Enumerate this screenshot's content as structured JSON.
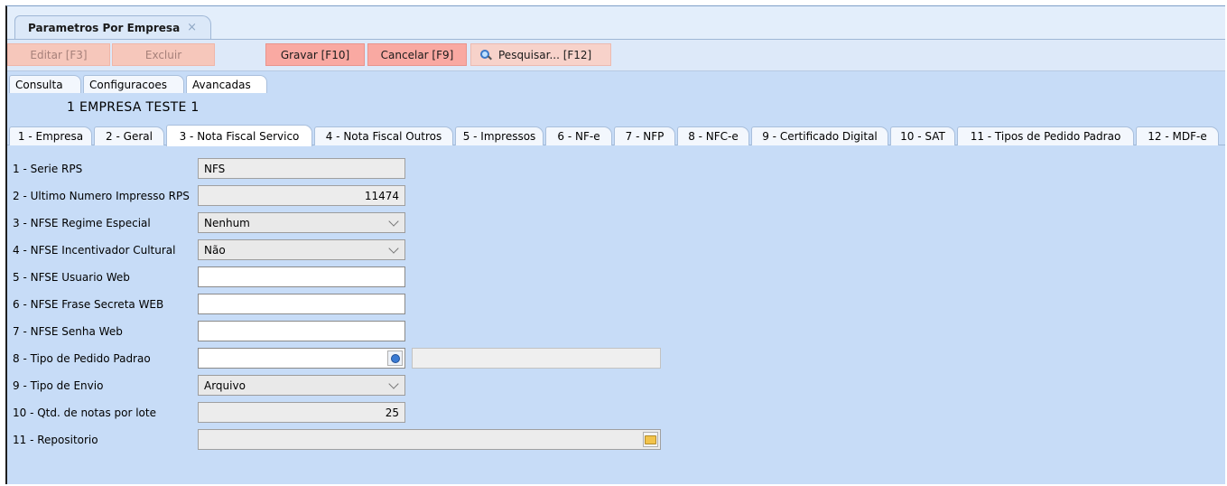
{
  "doc_tab": {
    "title": "Parametros Por Empresa",
    "close": "×"
  },
  "toolbar": {
    "edit": "Editar [F3]",
    "delete": "Excluir",
    "save": "Gravar [F10]",
    "cancel": "Cancelar [F9]",
    "search": "Pesquisar... [F12]"
  },
  "subtabs": [
    "Consulta",
    "Configuracoes",
    "Avancadas"
  ],
  "company": "1  EMPRESA TESTE 1",
  "tabs": [
    "1 - Empresa",
    "2 - Geral",
    "3 - Nota Fiscal Servico",
    "4 - Nota Fiscal Outros",
    "5 - Impressos",
    "6 - NF-e",
    "7 - NFP",
    "8 - NFC-e",
    "9 - Certificado Digital",
    "10 - SAT",
    "11 - Tipos de Pedido Padrao",
    "12 - MDF-e"
  ],
  "form": {
    "serie_rps": {
      "label": "1 - Serie RPS",
      "value": "NFS"
    },
    "ultimo_numero": {
      "label": "2 - Ultimo Numero Impresso RPS",
      "value": "11474"
    },
    "regime_especial": {
      "label": "3 - NFSE Regime Especial",
      "value": "Nenhum"
    },
    "incentivador": {
      "label": "4 - NFSE Incentivador Cultural",
      "value": "Não"
    },
    "usuario_web": {
      "label": "5 - NFSE Usuario Web",
      "value": ""
    },
    "frase_secreta": {
      "label": "6 - NFSE Frase Secreta WEB",
      "value": ""
    },
    "senha_web": {
      "label": "7 - NFSE Senha Web",
      "value": ""
    },
    "tipo_pedido": {
      "label": "8 - Tipo de Pedido Padrao",
      "value": "",
      "description": ""
    },
    "tipo_envio": {
      "label": "9 - Tipo de Envio",
      "value": "Arquivo"
    },
    "qtd_notas": {
      "label": "10 - Qtd. de notas por lote",
      "value": "25"
    },
    "repositorio": {
      "label": "11 - Repositorio",
      "value": ""
    }
  }
}
